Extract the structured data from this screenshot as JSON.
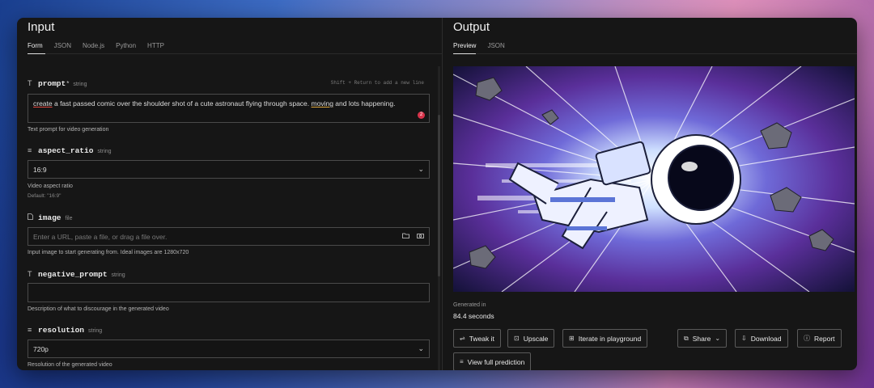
{
  "input": {
    "title": "Input",
    "tabs": [
      "Form",
      "JSON",
      "Node.js",
      "Python",
      "HTTP"
    ],
    "hint": "Shift + Return to add a new line",
    "fields": {
      "prompt": {
        "name": "prompt",
        "required": "*",
        "type": "string",
        "value_parts": [
          "create",
          " a fast passed comic over the shoulder shot of a cute astronaut flying through space. ",
          "moving",
          " and lots happening."
        ],
        "badge": "2",
        "description": "Text prompt for video generation"
      },
      "aspect_ratio": {
        "name": "aspect_ratio",
        "type": "string",
        "value": "16:9",
        "description": "Video aspect ratio",
        "default": "Default: \"16:9\""
      },
      "image": {
        "name": "image",
        "type": "file",
        "placeholder": "Enter a URL, paste a file, or drag a file over.",
        "description": "Input image to start generating from. Ideal images are 1280x720"
      },
      "negative_prompt": {
        "name": "negative_prompt",
        "type": "string",
        "value": "",
        "description": "Description of what to discourage in the generated video"
      },
      "resolution": {
        "name": "resolution",
        "type": "string",
        "value": "720p",
        "description": "Resolution of the generated video"
      }
    }
  },
  "output": {
    "title": "Output",
    "tabs": [
      "Preview",
      "JSON"
    ],
    "generated_label": "Generated in",
    "generated_value": "84.4 seconds",
    "buttons": {
      "tweak": "Tweak it",
      "upscale": "Upscale",
      "iterate": "Iterate in playground",
      "share": "Share",
      "download": "Download",
      "report": "Report",
      "view_full": "View full prediction"
    }
  },
  "colors": {
    "panel_bg": "#161616",
    "border": "#4a4a4a",
    "badge": "#d6334a"
  },
  "icons": {
    "text_field": "T",
    "list_field": "≡",
    "file_field": "file-icon",
    "select": "chevron-down",
    "folder": "folder-icon",
    "camera": "camera-icon"
  }
}
